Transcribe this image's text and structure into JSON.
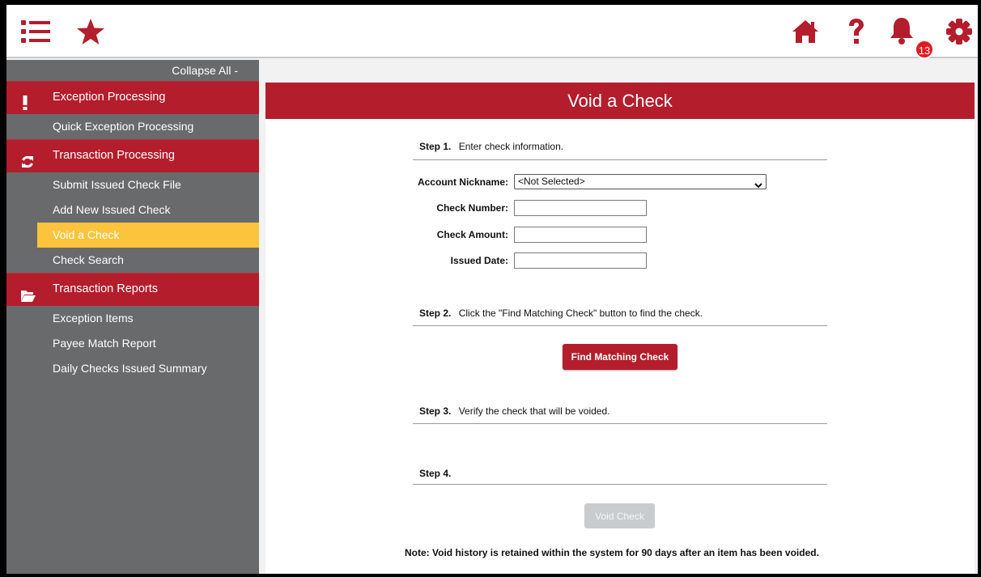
{
  "header": {
    "icons": [
      "list-icon",
      "star-icon",
      "home-icon",
      "help-icon",
      "bell-icon",
      "gear-icon"
    ],
    "notification_count": "13"
  },
  "sidebar": {
    "collapse_label": "Collapse All -",
    "sections": [
      {
        "label": "Exception Processing",
        "icon": "exclamation-icon",
        "items": [
          "Quick Exception Processing"
        ]
      },
      {
        "label": "Transaction Processing",
        "icon": "sync-icon",
        "items": [
          "Submit Issued Check File",
          "Add New Issued Check",
          "Void a Check",
          "Check Search"
        ]
      },
      {
        "label": "Transaction Reports",
        "icon": "folder-open-icon",
        "items": [
          "Exception Items",
          "Payee Match Report",
          "Daily Checks Issued Summary"
        ]
      }
    ],
    "active_item": "Void a Check"
  },
  "main": {
    "title": "Void a Check",
    "step1": {
      "label": "Step 1.",
      "text": "Enter check information."
    },
    "fields": {
      "account_nickname_label": "Account Nickname:",
      "account_nickname_value": "<Not Selected>",
      "check_number_label": "Check Number:",
      "check_number_value": "",
      "check_amount_label": "Check Amount:",
      "check_amount_value": "",
      "issued_date_label": "Issued Date:",
      "issued_date_value": ""
    },
    "step2": {
      "label": "Step 2.",
      "text": "Click the \"Find Matching Check\" button to find the check."
    },
    "find_button": "Find Matching Check",
    "step3": {
      "label": "Step 3.",
      "text": "Verify the check that will be voided."
    },
    "step4": {
      "label": "Step 4.",
      "text": ""
    },
    "void_button": "Void Check",
    "note": "Note: Void history is retained within the system for 90 days after an item has been voided."
  },
  "colors": {
    "brand_red": "#b41d2b",
    "active_yellow": "#fcc43d",
    "sidebar_gray": "#696a6c",
    "badge_red": "#e11b22"
  }
}
